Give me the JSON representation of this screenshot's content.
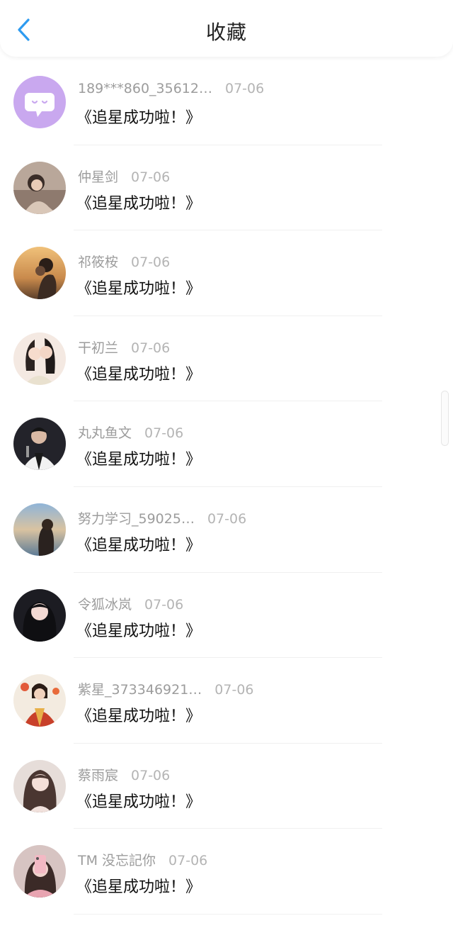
{
  "header": {
    "title": "收藏",
    "back_icon": "chevron-left-icon",
    "accent_color": "#2e9bf0"
  },
  "items": [
    {
      "name": "189***860_35612…",
      "date": "07-06",
      "content": "《追星成功啦！》"
    },
    {
      "name": "仲星剑",
      "date": "07-06",
      "content": "《追星成功啦！》"
    },
    {
      "name": "祁筱桉",
      "date": "07-06",
      "content": "《追星成功啦！》"
    },
    {
      "name": "干初兰",
      "date": "07-06",
      "content": "《追星成功啦！》"
    },
    {
      "name": "丸丸鱼文",
      "date": "07-06",
      "content": "《追星成功啦！》"
    },
    {
      "name": "努力学习_59025…",
      "date": "07-06",
      "content": "《追星成功啦！》"
    },
    {
      "name": "令狐冰岚",
      "date": "07-06",
      "content": "《追星成功啦！》"
    },
    {
      "name": "紫星_373346921…",
      "date": "07-06",
      "content": "《追星成功啦！》"
    },
    {
      "name": "蔡雨宸",
      "date": "07-06",
      "content": "《追星成功啦！》"
    },
    {
      "name": "TM 没忘記你",
      "date": "07-06",
      "content": "《追星成功啦！》"
    }
  ]
}
